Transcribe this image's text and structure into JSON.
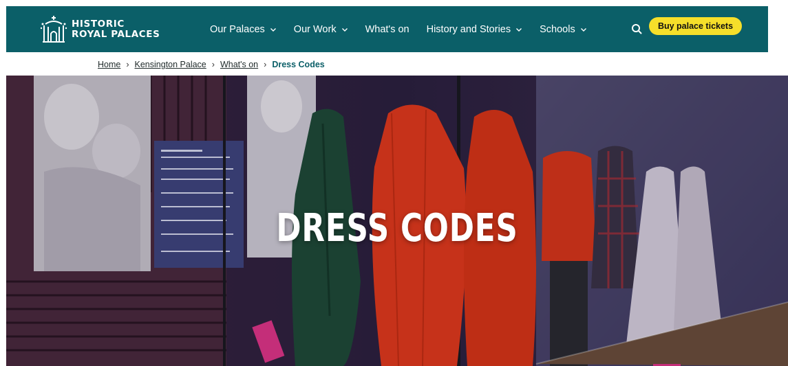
{
  "brand": {
    "logo_line1": "HISTORIC",
    "logo_line2": "ROYAL PALACES"
  },
  "nav": {
    "items": [
      {
        "label": "Our Palaces",
        "has_dropdown": true
      },
      {
        "label": "Our Work",
        "has_dropdown": true
      },
      {
        "label": "What's on",
        "has_dropdown": false
      },
      {
        "label": "History and Stories",
        "has_dropdown": true
      },
      {
        "label": "Schools",
        "has_dropdown": true
      }
    ],
    "search_icon": "search-icon",
    "cta_label": "Buy palace tickets"
  },
  "breadcrumb": {
    "items": [
      "Home",
      "Kensington Palace",
      "What's on"
    ],
    "current": "Dress Codes"
  },
  "hero": {
    "title": "DRESS CODES"
  },
  "colors": {
    "header_bg": "#0b5f68",
    "cta_bg": "#f6df2a",
    "current_crumb": "#0b5f68"
  }
}
